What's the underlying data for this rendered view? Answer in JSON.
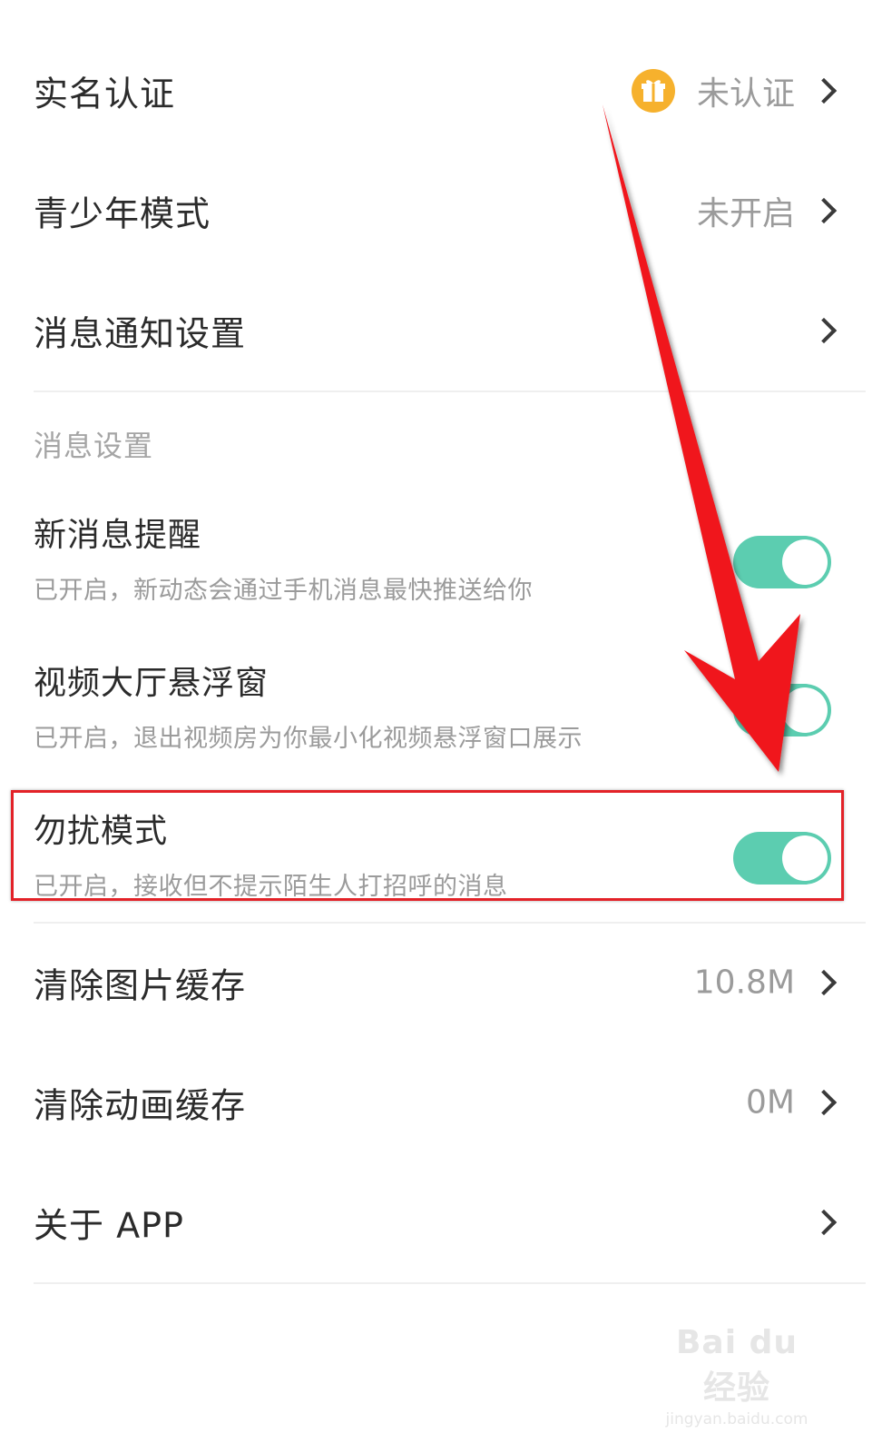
{
  "rows": {
    "real_name": {
      "title": "实名认证",
      "value": "未认证"
    },
    "youth_mode": {
      "title": "青少年模式",
      "value": "未开启"
    },
    "notification_settings": {
      "title": "消息通知设置"
    }
  },
  "message_section": {
    "label": "消息设置",
    "new_message": {
      "title": "新消息提醒",
      "subtitle": "已开启，新动态会通过手机消息最快推送给你",
      "enabled": true
    },
    "video_float": {
      "title": "视频大厅悬浮窗",
      "subtitle": "已开启，退出视频房为你最小化视频悬浮窗口展示",
      "enabled": true
    },
    "do_not_disturb": {
      "title": "勿扰模式",
      "subtitle": "已开启，接收但不提示陌生人打招呼的消息",
      "enabled": true
    }
  },
  "cache": {
    "image_cache": {
      "title": "清除图片缓存",
      "value": "10.8M"
    },
    "animation_cache": {
      "title": "清除动画缓存",
      "value": "0M"
    }
  },
  "about": {
    "title": "关于 APP"
  },
  "watermark": {
    "brand": "Bai du 经验",
    "url": "jingyan.baidu.com"
  },
  "colors": {
    "toggle_on": "#5ccdb0",
    "gift_icon": "#f6b12d",
    "annotation_red": "#e32228"
  }
}
